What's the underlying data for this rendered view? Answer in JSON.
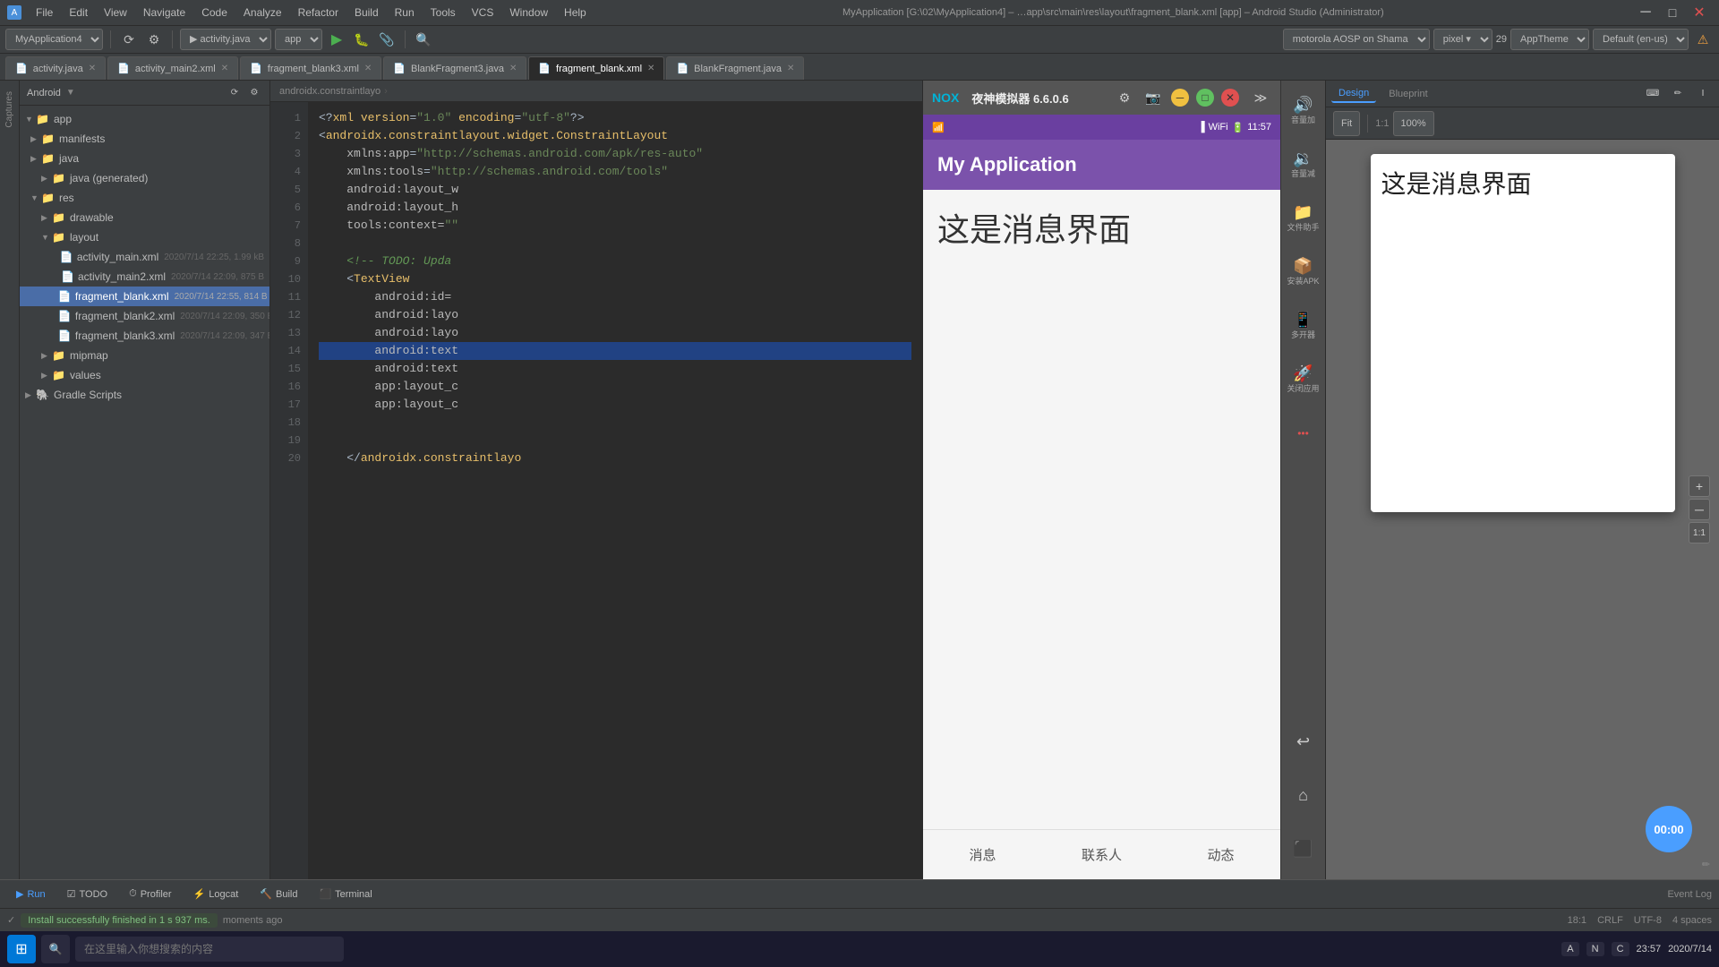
{
  "window": {
    "title": "MyApplication [G:\\02\\MyApplication4] – …app\\src\\main\\res\\layout\\fragment_blank.xml [app] – Android Studio (Administrator)"
  },
  "menu": {
    "app_name": "MyApplication4",
    "items": [
      "File",
      "Edit",
      "View",
      "Navigate",
      "Code",
      "Analyze",
      "Refactor",
      "Build",
      "Run",
      "Tools",
      "VCS",
      "Window",
      "Help"
    ]
  },
  "tabs": [
    {
      "label": "activity.java",
      "active": false,
      "icon": "📄"
    },
    {
      "label": "activity_main2.xml",
      "active": false,
      "icon": "📄"
    },
    {
      "label": "fragment_blank3.xml",
      "active": false,
      "icon": "📄"
    },
    {
      "label": "BlankFragment3.java",
      "active": false,
      "icon": "📄"
    },
    {
      "label": "fragment_blank.xml",
      "active": true,
      "icon": "📄"
    },
    {
      "label": "BlankFragment.java",
      "active": false,
      "icon": "📄"
    }
  ],
  "toolbar": {
    "project_dropdown": "MyApplication4",
    "run_config": "app",
    "module": "main",
    "res_label": "res",
    "layout_label": "layout",
    "file_label": "fragment_blank.xml"
  },
  "sidebar": {
    "header": "Android",
    "items": [
      {
        "label": "app",
        "indent": 0,
        "type": "folder",
        "expanded": true
      },
      {
        "label": "manifests",
        "indent": 1,
        "type": "folder",
        "expanded": false
      },
      {
        "label": "java",
        "indent": 1,
        "type": "folder",
        "expanded": true
      },
      {
        "label": "java (generated)",
        "indent": 2,
        "type": "folder",
        "expanded": false
      },
      {
        "label": "res",
        "indent": 1,
        "type": "folder",
        "expanded": true
      },
      {
        "label": "drawable",
        "indent": 2,
        "type": "folder",
        "expanded": false
      },
      {
        "label": "layout",
        "indent": 2,
        "type": "folder",
        "expanded": true
      },
      {
        "label": "activity_main.xml",
        "indent": 3,
        "type": "xml",
        "meta": "2020/7/14 22:25, 1.99 kB",
        "selected": false
      },
      {
        "label": "activity_main2.xml",
        "indent": 3,
        "type": "xml",
        "meta": "2020/7/14 22:09, 875 B",
        "selected": false
      },
      {
        "label": "fragment_blank.xml",
        "indent": 3,
        "type": "xml",
        "meta": "2020/7/14 22:55, 814 B",
        "selected": true,
        "highlighted": true
      },
      {
        "label": "fragment_blank2.xml",
        "indent": 3,
        "type": "xml",
        "meta": "2020/7/14 22:09, 350 B",
        "selected": false
      },
      {
        "label": "fragment_blank3.xml",
        "indent": 3,
        "type": "xml",
        "meta": "2020/7/14 22:09, 347 B",
        "selected": false
      },
      {
        "label": "mipmap",
        "indent": 2,
        "type": "folder",
        "expanded": false
      },
      {
        "label": "values",
        "indent": 2,
        "type": "folder",
        "expanded": false
      },
      {
        "label": "Gradle Scripts",
        "indent": 0,
        "type": "gradle",
        "expanded": false
      }
    ]
  },
  "editor": {
    "lines": [
      {
        "num": 1,
        "text": "<?xml version=\"1.0\" encoding=\"utf-8\"?>"
      },
      {
        "num": 2,
        "text": "<androidx.constraintlayout.widget.ConstraintLayout"
      },
      {
        "num": 3,
        "text": "    xmlns:app=\"http://schemas.android.com/apk/res-auto\""
      },
      {
        "num": 4,
        "text": "    xmlns:tools=\"http://schemas.android.com/tools\""
      },
      {
        "num": 5,
        "text": "    android:layout_w"
      },
      {
        "num": 6,
        "text": "    android:layout_h"
      },
      {
        "num": 7,
        "text": "    tools:context="
      },
      {
        "num": 8,
        "text": ""
      },
      {
        "num": 9,
        "text": "    <!-- TODO: Upda"
      },
      {
        "num": 10,
        "text": "    <TextView"
      },
      {
        "num": 11,
        "text": "        android:id="
      },
      {
        "num": 12,
        "text": "        android:layo"
      },
      {
        "num": 13,
        "text": "        android:layo"
      },
      {
        "num": 14,
        "text": "        android:text"
      },
      {
        "num": 15,
        "text": "        android:text"
      },
      {
        "num": 16,
        "text": "        app:layout_c"
      },
      {
        "num": 17,
        "text": "        app:layout_c"
      },
      {
        "num": 18,
        "text": ""
      },
      {
        "num": 19,
        "text": ""
      },
      {
        "num": 20,
        "text": "    </androidx.constraintlayo"
      }
    ],
    "status": "18:1  CRLF  UTF-8  4 spaces"
  },
  "emulator": {
    "title": "夜神模拟器 6.6.0.6",
    "status_bar": {
      "time": "11:57"
    },
    "app_title": "My Application",
    "main_text": "这是消息界面",
    "bottom_buttons": [
      "消息",
      "联系人",
      "动态"
    ]
  },
  "right_panel": {
    "device": "motorola AOSP on Shama",
    "api_level": "29",
    "theme": "AppTheme",
    "locale": "Default (en-us)",
    "preview_text": "这是消息界面"
  },
  "emulator_sidebar": {
    "buttons": [
      {
        "icon": "🔊",
        "label": "音量加"
      },
      {
        "icon": "🔉",
        "label": "音量减"
      },
      {
        "icon": "📁",
        "label": "文件助手"
      },
      {
        "icon": "📦",
        "label": "安装APK"
      },
      {
        "icon": "📱",
        "label": "多开器"
      },
      {
        "icon": "🚀",
        "label": "关闭应用"
      },
      {
        "icon": "•••",
        "label": ""
      }
    ]
  },
  "status": {
    "install_message": "Install successfully finished in 1 s 937 ms.",
    "time_ago": "moments ago",
    "position": "18:1",
    "line_sep": "CRLF",
    "encoding": "UTF-8",
    "indent": "4 spaces"
  },
  "bottom_tools": {
    "buttons": [
      "▶ Run",
      "☑ TODO",
      "⏱ Profiler",
      "⚡ Logcat",
      "🔨 Build",
      "⬛ Terminal"
    ]
  },
  "timer": {
    "value": "00:00"
  }
}
